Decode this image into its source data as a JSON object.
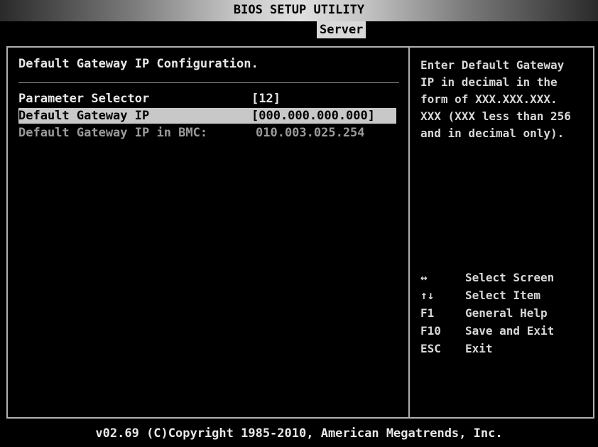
{
  "header": {
    "title": "BIOS SETUP UTILITY",
    "active_tab": "Server"
  },
  "main": {
    "section_title": "Default Gateway IP Configuration.",
    "items": [
      {
        "label": "Parameter Selector",
        "value": "[12]",
        "state": "normal"
      },
      {
        "label": "Default Gateway IP",
        "value": "[000.000.000.000]",
        "state": "selected"
      },
      {
        "label": "Default Gateway IP in BMC:",
        "value": "010.003.025.254",
        "state": "read-only"
      }
    ]
  },
  "help": {
    "text": "Enter Default Gateway\nIP in decimal in the\nform of XXX.XXX.XXX.\nXXX (XXX less than 256\nand in decimal only)."
  },
  "keys": [
    {
      "key": "↔",
      "desc": "Select Screen"
    },
    {
      "key": "↑↓",
      "desc": "Select Item"
    },
    {
      "key": "F1",
      "desc": "General Help"
    },
    {
      "key": "F10",
      "desc": "Save and Exit"
    },
    {
      "key": "ESC",
      "desc": "Exit"
    }
  ],
  "footer": {
    "text": "v02.69 (C)Copyright 1985-2010, American Megatrends, Inc."
  },
  "colors": {
    "background": "#000000",
    "highlight": "#c8c8c8",
    "text": "#d8d8d8",
    "disabled_text": "#9a9a9a"
  }
}
